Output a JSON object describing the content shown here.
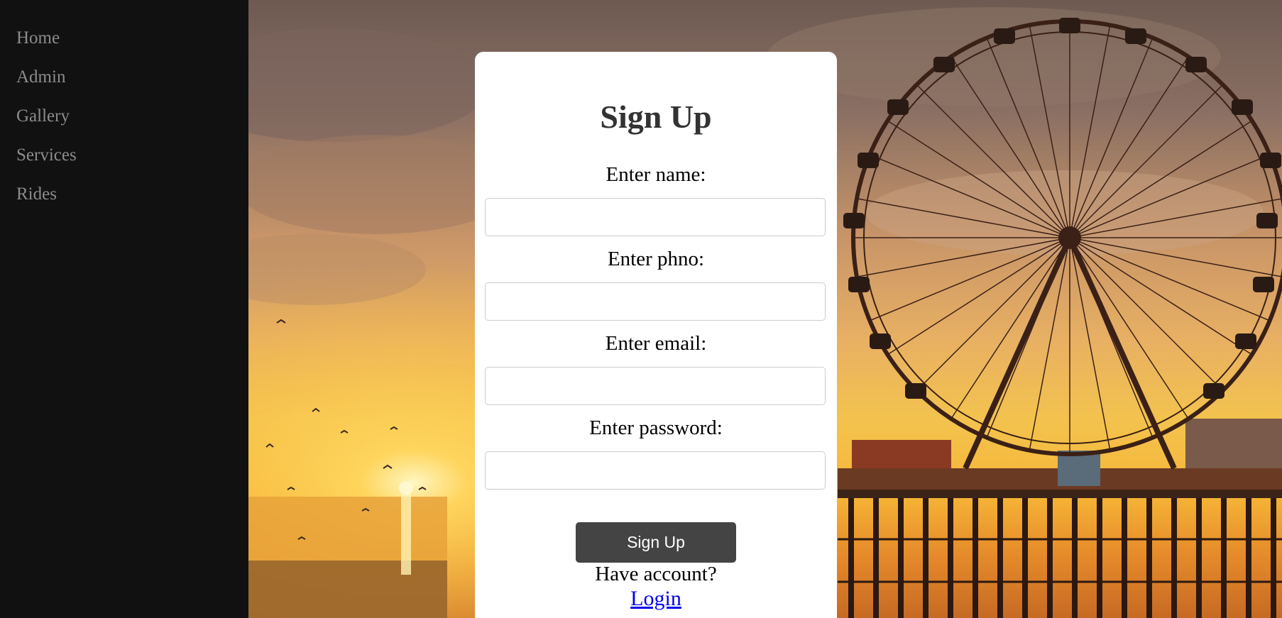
{
  "sidebar": {
    "items": [
      {
        "label": "Home"
      },
      {
        "label": "Admin"
      },
      {
        "label": "Gallery"
      },
      {
        "label": "Services"
      },
      {
        "label": "Rides"
      }
    ]
  },
  "form": {
    "title": "Sign Up",
    "fields": [
      {
        "label": "Enter name:",
        "value": ""
      },
      {
        "label": "Enter phno:",
        "value": ""
      },
      {
        "label": "Enter email:",
        "value": ""
      },
      {
        "label": "Enter password:",
        "value": ""
      }
    ],
    "submit_label": "Sign Up",
    "have_account_text": "Have account?",
    "login_label": "Login"
  },
  "colors": {
    "sidebar_bg": "#111111",
    "nav_text": "#8c8c8c",
    "button_bg": "#444444",
    "link": "#0000ee"
  }
}
